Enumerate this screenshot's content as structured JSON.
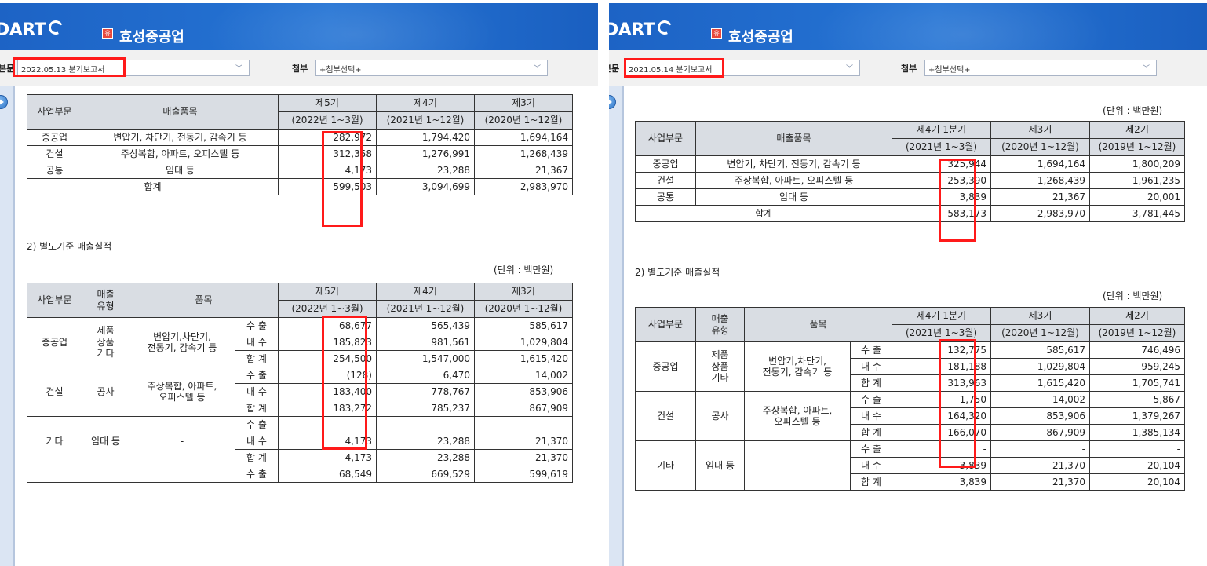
{
  "left": {
    "header": {
      "logo": "DART",
      "company_badge": "유",
      "company": "효성중공업"
    },
    "toolbar": {
      "main_label": "본문",
      "main_value": "2022.05.13  분기보고서",
      "attach_label": "첨부",
      "attach_value": "+첨부선택+"
    },
    "table1": {
      "head": {
        "segment": "사업부문",
        "product": "매출품목",
        "p1": "제5기",
        "p1_range": "(2022년 1~3월)",
        "p2": "제4기",
        "p2_range": "(2021년 1~12월)",
        "p3": "제3기",
        "p3_range": "(2020년 1~12월)"
      },
      "rows": [
        {
          "segment": "중공업",
          "product": "변압기, 차단기, 전동기, 감속기 등",
          "v1": "282,972",
          "v2": "1,794,420",
          "v3": "1,694,164"
        },
        {
          "segment": "건설",
          "product": "주상복합, 아파트, 오피스텔 등",
          "v1": "312,358",
          "v2": "1,276,991",
          "v3": "1,268,439"
        },
        {
          "segment": "공통",
          "product": "임대 등",
          "v1": "4,173",
          "v2": "23,288",
          "v3": "21,367"
        }
      ],
      "total": {
        "label": "합계",
        "v1": "599,503",
        "v2": "3,094,699",
        "v3": "2,983,970"
      }
    },
    "section2_title": "2) 별도기준 매출실적",
    "unit": "(단위 : 백만원)",
    "table2": {
      "head": {
        "segment": "사업부문",
        "type": "매출\n유형",
        "product": "품목",
        "p1": "제5기",
        "p1_range": "(2022년 1~3월)",
        "p2": "제4기",
        "p2_range": "(2021년 1~12월)",
        "p3": "제3기",
        "p3_range": "(2020년 1~12월)"
      },
      "groups": [
        {
          "segment": "중공업",
          "type": "제품\n상품\n기타",
          "product": "변압기,차단기,\n전동기, 감속기 등",
          "rows": [
            {
              "kind": "수 출",
              "v1": "68,677",
              "v2": "565,439",
              "v3": "585,617"
            },
            {
              "kind": "내 수",
              "v1": "185,823",
              "v2": "981,561",
              "v3": "1,029,804"
            },
            {
              "kind": "합 계",
              "v1": "254,500",
              "v2": "1,547,000",
              "v3": "1,615,420"
            }
          ]
        },
        {
          "segment": "건설",
          "type": "공사",
          "product": "주상복합, 아파트,\n오피스텔 등",
          "rows": [
            {
              "kind": "수 출",
              "v1": "(128)",
              "v2": "6,470",
              "v3": "14,002"
            },
            {
              "kind": "내 수",
              "v1": "183,400",
              "v2": "778,767",
              "v3": "853,906"
            },
            {
              "kind": "합 계",
              "v1": "183,272",
              "v2": "785,237",
              "v3": "867,909"
            }
          ]
        },
        {
          "segment": "기타",
          "type": "임대 등",
          "product": "-",
          "rows": [
            {
              "kind": "수 출",
              "v1": "-",
              "v2": "-",
              "v3": "-"
            },
            {
              "kind": "내 수",
              "v1": "4,173",
              "v2": "23,288",
              "v3": "21,370"
            },
            {
              "kind": "합 계",
              "v1": "4,173",
              "v2": "23,288",
              "v3": "21,370"
            }
          ]
        }
      ],
      "partial_row": {
        "kind": "수 출",
        "v1": "68,549",
        "v2": "669,529",
        "v3": "599,619"
      }
    }
  },
  "right": {
    "header": {
      "logo": "DART",
      "company_badge": "유",
      "company": "효성중공업"
    },
    "toolbar": {
      "main_label": "본문",
      "main_value": "2021.05.14  분기보고서",
      "attach_label": "첨부",
      "attach_value": "+첨부선택+"
    },
    "unit": "(단위 : 백만원)",
    "table1": {
      "head": {
        "segment": "사업부문",
        "product": "매출품목",
        "p1": "제4기 1분기",
        "p1_range": "(2021년 1~3월)",
        "p2": "제3기",
        "p2_range": "(2020년 1~12월)",
        "p3": "제2기",
        "p3_range": "(2019년 1~12월)"
      },
      "rows": [
        {
          "segment": "중공업",
          "product": "변압기, 차단기, 전동기, 감속기 등",
          "v1": "325,944",
          "v2": "1,694,164",
          "v3": "1,800,209"
        },
        {
          "segment": "건설",
          "product": "주상복합, 아파트, 오피스텔 등",
          "v1": "253,390",
          "v2": "1,268,439",
          "v3": "1,961,235"
        },
        {
          "segment": "공통",
          "product": "임대 등",
          "v1": "3,839",
          "v2": "21,367",
          "v3": "20,001"
        }
      ],
      "total": {
        "label": "합계",
        "v1": "583,173",
        "v2": "2,983,970",
        "v3": "3,781,445"
      }
    },
    "section2_title": "2) 별도기준 매출실적",
    "unit2": "(단위 : 백만원)",
    "table2": {
      "head": {
        "segment": "사업부문",
        "type": "매출\n유형",
        "product": "품목",
        "p1": "제4기 1분기",
        "p1_range": "(2021년 1~3월)",
        "p2": "제3기",
        "p2_range": "(2020년 1~12월)",
        "p3": "제2기",
        "p3_range": "(2019년 1~12월)"
      },
      "groups": [
        {
          "segment": "중공업",
          "type": "제품\n상품\n기타",
          "product": "변압기,차단기,\n전동기, 감속기 등",
          "rows": [
            {
              "kind": "수 출",
              "v1": "132,775",
              "v2": "585,617",
              "v3": "746,496"
            },
            {
              "kind": "내 수",
              "v1": "181,188",
              "v2": "1,029,804",
              "v3": "959,245"
            },
            {
              "kind": "합 계",
              "v1": "313,963",
              "v2": "1,615,420",
              "v3": "1,705,741"
            }
          ]
        },
        {
          "segment": "건설",
          "type": "공사",
          "product": "주상복합, 아파트,\n오피스텔 등",
          "rows": [
            {
              "kind": "수 출",
              "v1": "1,750",
              "v2": "14,002",
              "v3": "5,867"
            },
            {
              "kind": "내 수",
              "v1": "164,320",
              "v2": "853,906",
              "v3": "1,379,267"
            },
            {
              "kind": "합 계",
              "v1": "166,070",
              "v2": "867,909",
              "v3": "1,385,134"
            }
          ]
        },
        {
          "segment": "기타",
          "type": "임대 등",
          "product": "-",
          "rows": [
            {
              "kind": "수 출",
              "v1": "-",
              "v2": "-",
              "v3": "-"
            },
            {
              "kind": "내 수",
              "v1": "3,839",
              "v2": "21,370",
              "v3": "20,104"
            },
            {
              "kind": "합 계",
              "v1": "3,839",
              "v2": "21,370",
              "v3": "20,104"
            }
          ]
        }
      ]
    }
  }
}
